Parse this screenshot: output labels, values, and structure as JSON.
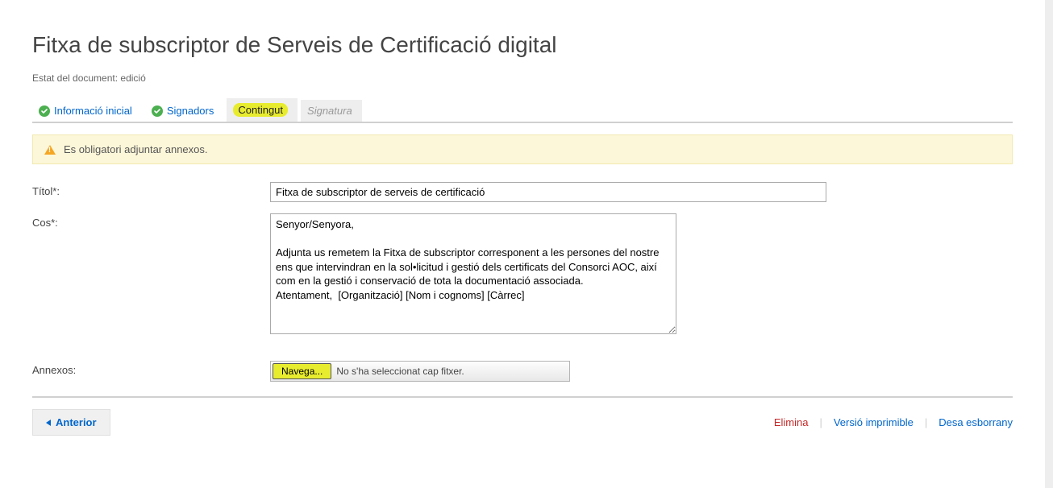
{
  "header": {
    "title": "Fitxa de subscriptor de Serveis de Certificació digital",
    "status": "Estat del document: edició"
  },
  "tabs": {
    "info": "Informació inicial",
    "signers": "Signadors",
    "content": "Contingut",
    "signature": "Signatura"
  },
  "warning": {
    "text": "Es obligatori adjuntar annexos."
  },
  "form": {
    "title_label": "Títol*:",
    "title_value": "Fitxa de subscriptor de serveis de certificació",
    "body_label": "Cos*:",
    "body_value": "Senyor/Senyora,\n\nAdjunta us remetem la Fitxa de subscriptor corresponent a les persones del nostre ens que intervindran en la sol•licitud i gestió dels certificats del Consorci AOC, així com en la gestió i conservació de tota la documentació associada.\nAtentament,  [Organització] [Nom i cognoms] [Càrrec]",
    "attachments_label": "Annexos:",
    "browse_label": "Navega...",
    "file_status": "No s'ha seleccionat cap fitxer."
  },
  "footer": {
    "prev": "Anterior",
    "delete": "Elimina",
    "print": "Versió imprimible",
    "save_draft": "Desa esborrany"
  }
}
